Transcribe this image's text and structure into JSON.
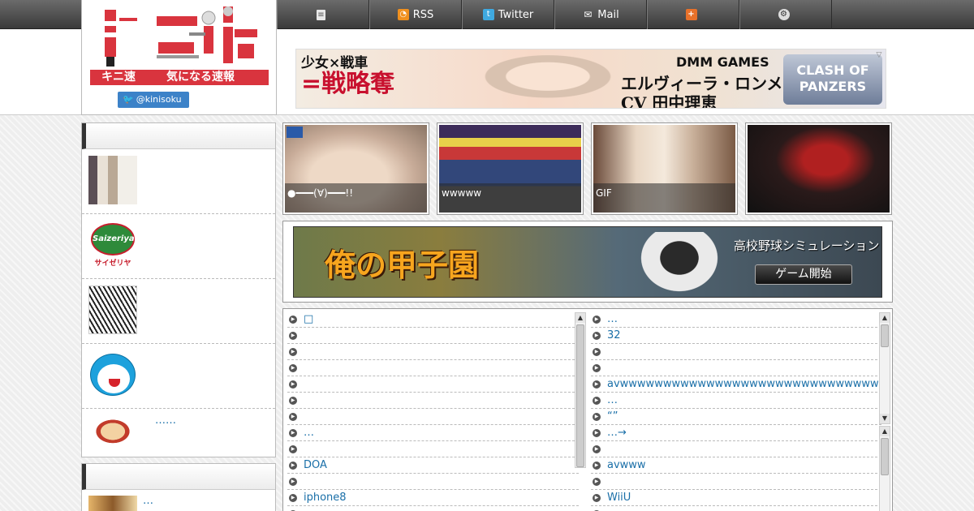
{
  "site": {
    "logo_name": "キニ速",
    "logo_tagline": "気になる速報",
    "twitter_handle": "@kinisoku"
  },
  "nav": {
    "items": [
      {
        "label": "",
        "icon": "document-icon"
      },
      {
        "label": "RSS",
        "icon": "rss-icon"
      },
      {
        "label": "Twitter",
        "icon": "twitter-icon"
      },
      {
        "label": "Mail",
        "icon": "mail-icon"
      },
      {
        "label": "",
        "icon": "plus-icon"
      },
      {
        "label": "",
        "icon": "gear-icon"
      }
    ]
  },
  "header_ad": {
    "line1": "少女×戦車",
    "line2": "=戦略奪",
    "brand": "DMM GAMES",
    "character": "エルヴィーラ・ロンメル",
    "cv": "CV 田中理恵",
    "logo": "CLASH OF PANZERS"
  },
  "sidebar": {
    "box1_items": [
      {
        "text": ""
      },
      {
        "text": ""
      },
      {
        "text": ""
      },
      {
        "text": ""
      },
      {
        "text": "……"
      }
    ],
    "box2_items": [
      {
        "text": "…"
      }
    ]
  },
  "thumbnails": [
    {
      "caption": "●━━━(∀)━━━!!"
    },
    {
      "caption": "wwwww"
    },
    {
      "caption": "GIF"
    },
    {
      "caption": ""
    }
  ],
  "game_banner": {
    "title": "俺の甲子園",
    "subtitle": "高校野球シミュレーション",
    "button": "ゲーム開始"
  },
  "link_list_left": [
    "□",
    "",
    "",
    "",
    "",
    "",
    "",
    "…",
    "",
    "DOA",
    "",
    "iphone8",
    ""
  ],
  "link_list_right": [
    "…",
    "32",
    "",
    "",
    "avwwwwwwwwwwwwwwwwwwwwwwwwwwwwwww",
    "…",
    "“”",
    "…→",
    "",
    " avwww",
    "",
    "WiiU",
    ""
  ]
}
